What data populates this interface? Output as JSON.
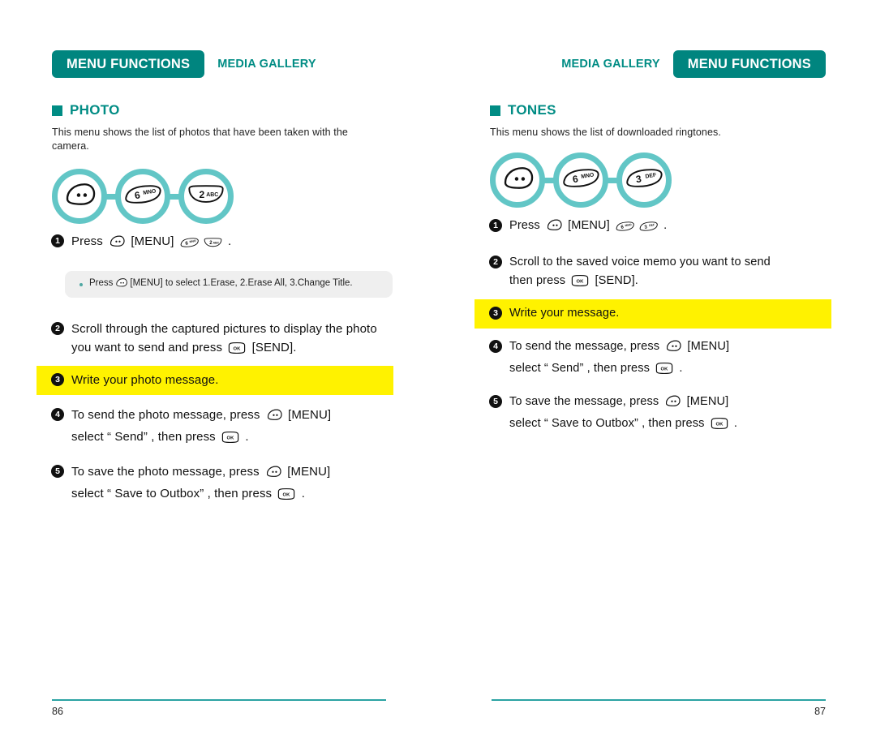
{
  "left_page": {
    "header": {
      "primary_tag": "MENU FUNCTIONS",
      "secondary_tag": "MEDIA GALLERY"
    },
    "section_title": "PHOTO",
    "intro": "This menu shows the list of photos that have been taken with the camera.",
    "keyflow": [
      {
        "icon": "menu-softkey-icon",
        "label": ""
      },
      {
        "icon": "keypad-key-icon",
        "digit": "6",
        "letters": "MNO"
      },
      {
        "icon": "keypad-key-icon",
        "digit": "2",
        "letters": "ABC"
      }
    ],
    "steps": [
      {
        "number": "1",
        "parts": [
          {
            "type": "text",
            "value": "Press "
          },
          {
            "type": "key",
            "key": "menu-softkey"
          },
          {
            "type": "text",
            "value": " [MENU] "
          },
          {
            "type": "key",
            "key": "6MNO"
          },
          {
            "type": "key",
            "key": "2ABC"
          },
          {
            "type": "text",
            "value": " ."
          }
        ],
        "highlight": false
      },
      {
        "number": "2",
        "parts": [
          {
            "type": "text",
            "value": "Scroll through the captured pictures to display the photo you want to send and press "
          },
          {
            "type": "key",
            "key": "ok"
          },
          {
            "type": "text",
            "value": " [SEND]."
          }
        ],
        "highlight": false
      },
      {
        "number": "3",
        "parts": [
          {
            "type": "text",
            "value": "Write your photo message."
          }
        ],
        "highlight": true
      },
      {
        "number": "4",
        "parts": [
          {
            "type": "text",
            "value": "To send the photo message, press "
          },
          {
            "type": "key",
            "key": "menu-softkey"
          },
          {
            "type": "text",
            "value": " [MENU]"
          },
          {
            "type": "br"
          },
          {
            "type": "text",
            "value": "select “ Send” , then press "
          },
          {
            "type": "key",
            "key": "ok"
          },
          {
            "type": "text",
            "value": " ."
          }
        ],
        "highlight": false
      },
      {
        "number": "5",
        "parts": [
          {
            "type": "text",
            "value": "To save the photo message, press "
          },
          {
            "type": "key",
            "key": "menu-softkey"
          },
          {
            "type": "text",
            "value": " [MENU]"
          },
          {
            "type": "br"
          },
          {
            "type": "text",
            "value": "select “ Save to Outbox” , then press "
          },
          {
            "type": "key",
            "key": "ok"
          },
          {
            "type": "text",
            "value": " ."
          }
        ],
        "highlight": false
      }
    ],
    "note": {
      "bullet": "•",
      "parts": [
        {
          "type": "text",
          "value": "Press"
        },
        {
          "type": "key",
          "key": "menu-softkey-sm"
        },
        {
          "type": "text",
          "value": "[MENU] to select 1.Erase, 2.Erase All, 3.Change Title."
        }
      ]
    },
    "page_number": "86"
  },
  "right_page": {
    "header": {
      "primary_tag": "MENU FUNCTIONS",
      "secondary_tag": "MEDIA GALLERY"
    },
    "section_title": "TONES",
    "intro": "This menu shows the list of downloaded ringtones.",
    "keyflow": [
      {
        "icon": "menu-softkey-icon",
        "label": ""
      },
      {
        "icon": "keypad-key-icon",
        "digit": "6",
        "letters": "MNO"
      },
      {
        "icon": "keypad-key-icon",
        "digit": "3",
        "letters": "DEF"
      }
    ],
    "steps": [
      {
        "number": "1",
        "parts": [
          {
            "type": "text",
            "value": "Press "
          },
          {
            "type": "key",
            "key": "menu-softkey"
          },
          {
            "type": "text",
            "value": " [MENU] "
          },
          {
            "type": "key",
            "key": "6MNO"
          },
          {
            "type": "key",
            "key": "3DEF"
          },
          {
            "type": "text",
            "value": " ."
          }
        ],
        "highlight": false
      },
      {
        "number": "2",
        "parts": [
          {
            "type": "text",
            "value": "Scroll to the saved voice memo you want to send"
          },
          {
            "type": "br"
          },
          {
            "type": "text",
            "value": "then press "
          },
          {
            "type": "key",
            "key": "ok"
          },
          {
            "type": "text",
            "value": " [SEND]."
          }
        ],
        "highlight": false
      },
      {
        "number": "3",
        "parts": [
          {
            "type": "text",
            "value": "Write your message."
          }
        ],
        "highlight": true
      },
      {
        "number": "4",
        "parts": [
          {
            "type": "text",
            "value": "To send the message, press "
          },
          {
            "type": "key",
            "key": "menu-softkey"
          },
          {
            "type": "text",
            "value": " [MENU]"
          },
          {
            "type": "br"
          },
          {
            "type": "text",
            "value": "select “ Send” , then press "
          },
          {
            "type": "key",
            "key": "ok"
          },
          {
            "type": "text",
            "value": " ."
          }
        ],
        "highlight": false
      },
      {
        "number": "5",
        "parts": [
          {
            "type": "text",
            "value": "To save the message, press "
          },
          {
            "type": "key",
            "key": "menu-softkey"
          },
          {
            "type": "text",
            "value": " [MENU]"
          },
          {
            "type": "br"
          },
          {
            "type": "text",
            "value": "select “ Save to Outbox” , then press "
          },
          {
            "type": "key",
            "key": "ok"
          },
          {
            "type": "text",
            "value": " ."
          }
        ],
        "highlight": false
      }
    ],
    "page_number": "87"
  },
  "colors": {
    "brand_teal_dark": "#00857F",
    "brand_teal": "#008C84",
    "circle_teal": "#62C6C6",
    "rule_teal": "#2AA3A3",
    "highlight_yellow": "#FFF200",
    "note_gray": "#EFEFEF"
  }
}
